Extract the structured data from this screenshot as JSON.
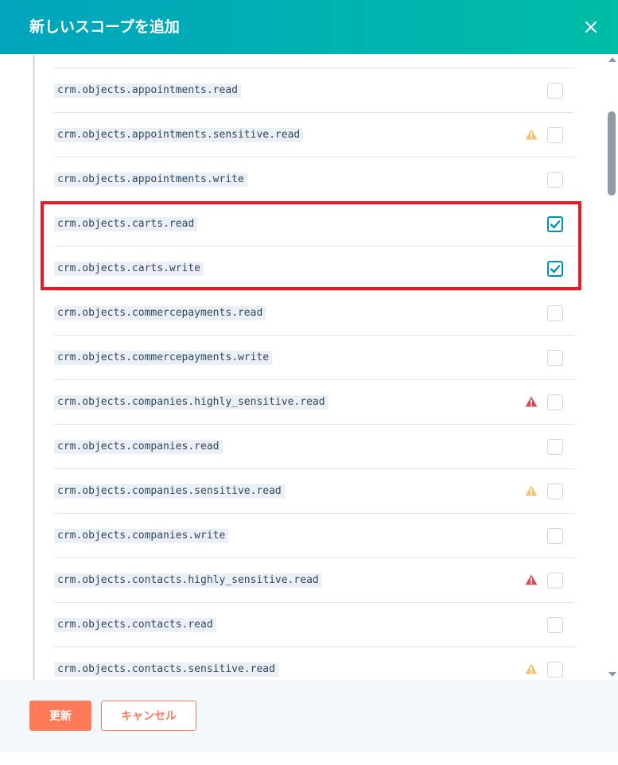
{
  "modal": {
    "title": "新しいスコープを追加",
    "close_icon": "close-icon"
  },
  "scopes": [
    {
      "name": "crm.objects.appointments.read",
      "checked": false,
      "warning": null
    },
    {
      "name": "crm.objects.appointments.sensitive.read",
      "checked": false,
      "warning": "sensitive"
    },
    {
      "name": "crm.objects.appointments.write",
      "checked": false,
      "warning": null
    },
    {
      "name": "crm.objects.carts.read",
      "checked": true,
      "warning": null
    },
    {
      "name": "crm.objects.carts.write",
      "checked": true,
      "warning": null
    },
    {
      "name": "crm.objects.commercepayments.read",
      "checked": false,
      "warning": null
    },
    {
      "name": "crm.objects.commercepayments.write",
      "checked": false,
      "warning": null
    },
    {
      "name": "crm.objects.companies.highly_sensitive.read",
      "checked": false,
      "warning": "highly_sensitive"
    },
    {
      "name": "crm.objects.companies.read",
      "checked": false,
      "warning": null
    },
    {
      "name": "crm.objects.companies.sensitive.read",
      "checked": false,
      "warning": "sensitive"
    },
    {
      "name": "crm.objects.companies.write",
      "checked": false,
      "warning": null
    },
    {
      "name": "crm.objects.contacts.highly_sensitive.read",
      "checked": false,
      "warning": "highly_sensitive"
    },
    {
      "name": "crm.objects.contacts.read",
      "checked": false,
      "warning": null
    },
    {
      "name": "crm.objects.contacts.sensitive.read",
      "checked": false,
      "warning": "sensitive"
    }
  ],
  "colors": {
    "header_start": "#00a4bd",
    "header_end": "#00bda5",
    "accent": "#ff7a59",
    "checkbox_checked": "#0091ae",
    "warning_sensitive": "#f5c26b",
    "warning_highly_sensitive": "#d94c53",
    "highlight": "#e21c24"
  },
  "footer": {
    "update_label": "更新",
    "cancel_label": "キャンセル"
  }
}
